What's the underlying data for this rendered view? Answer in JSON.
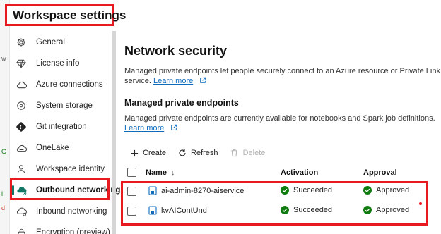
{
  "panel_title": "Workspace settings",
  "sidebar": {
    "items": [
      {
        "label": "General",
        "icon": "gear-icon"
      },
      {
        "label": "License info",
        "icon": "diamond-icon"
      },
      {
        "label": "Azure connections",
        "icon": "cloud-icon"
      },
      {
        "label": "System storage",
        "icon": "storage-icon"
      },
      {
        "label": "Git integration",
        "icon": "git-icon"
      },
      {
        "label": "OneLake",
        "icon": "onelake-icon"
      },
      {
        "label": "Workspace identity",
        "icon": "identity-icon"
      },
      {
        "label": "Outbound networking",
        "icon": "cloud-network-icon",
        "selected": true
      },
      {
        "label": "Inbound networking",
        "icon": "inbound-network-icon"
      },
      {
        "label": "Encryption (preview)",
        "icon": "lock-icon"
      }
    ]
  },
  "main": {
    "title": "Network security",
    "description": "Managed private endpoints let people securely connect to an Azure resource or Private Link",
    "description_line2": "service.",
    "learn_more": "Learn more",
    "section_title": "Managed private endpoints",
    "section_description": "Managed private endpoints are currently available for notebooks and Spark job definitions.",
    "section_learn_more": "Learn more",
    "toolbar": {
      "create": "Create",
      "refresh": "Refresh",
      "delete": "Delete"
    },
    "table": {
      "columns": [
        "Name",
        "Activation",
        "Approval"
      ],
      "rows": [
        {
          "name": "ai-admin-8270-aiservice",
          "activation": "Succeeded",
          "approval": "Approved"
        },
        {
          "name": "kvAIContUnd",
          "activation": "Succeeded",
          "approval": "Approved"
        }
      ]
    }
  },
  "colors": {
    "highlight_red": "#e8191f",
    "link_blue": "#0f6cbd",
    "success_green": "#107c10",
    "selection_teal": "#117865"
  }
}
